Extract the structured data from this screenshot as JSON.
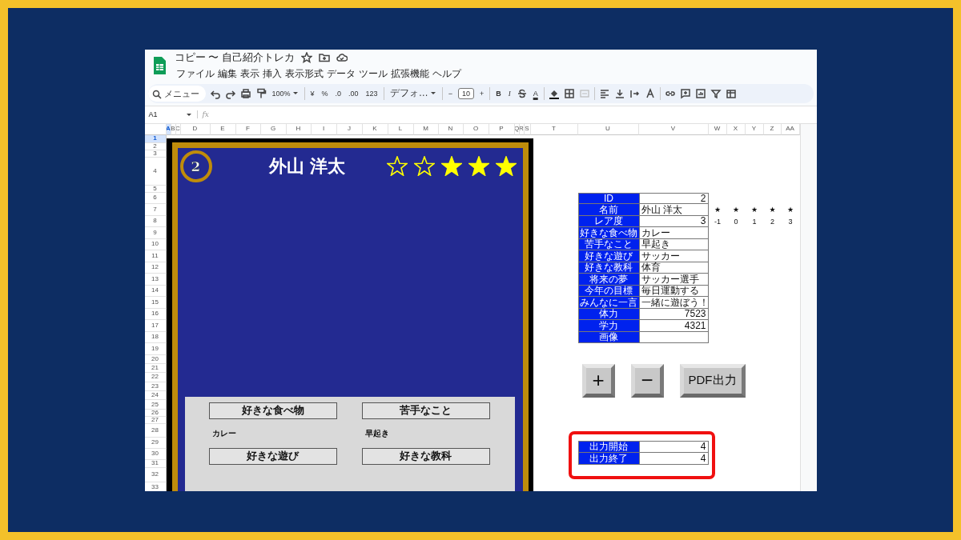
{
  "window": {
    "title": "コピー 〜 自己紹介トレカ"
  },
  "menu": [
    "ファイル",
    "編集",
    "表示",
    "挿入",
    "表示形式",
    "データ",
    "ツール",
    "拡張機能",
    "ヘルプ"
  ],
  "toolbar": {
    "search_placeholder": "メニュー",
    "zoom": "100%",
    "currency": "¥",
    "percent": "%",
    "decrease_decimal": ".0",
    "increase_decimal": ".00",
    "number_format": "123",
    "font": "デフォ…",
    "minus": "−",
    "font_size": "10",
    "plus": "+",
    "bold": "B",
    "italic": "I",
    "text_color": "A"
  },
  "formula_bar": {
    "cell_ref": "A1",
    "fx": "fx"
  },
  "columns": [
    {
      "label": "A",
      "selected": true
    },
    {
      "label": "B",
      "selected": false
    },
    {
      "label": "C",
      "selected": false
    },
    {
      "label": "D",
      "selected": false
    },
    {
      "label": "E",
      "selected": false
    },
    {
      "label": "F",
      "selected": false
    },
    {
      "label": "G",
      "selected": false
    },
    {
      "label": "H",
      "selected": false
    },
    {
      "label": "I",
      "selected": false
    },
    {
      "label": "J",
      "selected": false
    },
    {
      "label": "K",
      "selected": false
    },
    {
      "label": "L",
      "selected": false
    },
    {
      "label": "M",
      "selected": false
    },
    {
      "label": "N",
      "selected": false
    },
    {
      "label": "O",
      "selected": false
    },
    {
      "label": "P",
      "selected": false
    },
    {
      "label": "Q",
      "selected": false
    },
    {
      "label": "R",
      "selected": false
    },
    {
      "label": "S",
      "selected": false
    },
    {
      "label": "T",
      "selected": false
    },
    {
      "label": "U",
      "selected": false
    },
    {
      "label": "V",
      "selected": false
    },
    {
      "label": "W",
      "selected": false
    },
    {
      "label": "X",
      "selected": false
    },
    {
      "label": "Y",
      "selected": false
    },
    {
      "label": "Z",
      "selected": false
    },
    {
      "label": "AA",
      "selected": false
    }
  ],
  "rows": [
    {
      "label": "1",
      "selected": true
    },
    {
      "label": "2",
      "selected": false
    },
    {
      "label": "3",
      "selected": false
    },
    {
      "label": "4",
      "selected": false
    },
    {
      "label": "5",
      "selected": false
    },
    {
      "label": "6",
      "selected": false
    },
    {
      "label": "7",
      "selected": false
    },
    {
      "label": "8",
      "selected": false
    },
    {
      "label": "9",
      "selected": false
    },
    {
      "label": "10",
      "selected": false
    },
    {
      "label": "11",
      "selected": false
    },
    {
      "label": "12",
      "selected": false
    },
    {
      "label": "13",
      "selected": false
    },
    {
      "label": "14",
      "selected": false
    },
    {
      "label": "15",
      "selected": false
    },
    {
      "label": "16",
      "selected": false
    },
    {
      "label": "17",
      "selected": false
    },
    {
      "label": "18",
      "selected": false
    },
    {
      "label": "19",
      "selected": false
    },
    {
      "label": "20",
      "selected": false
    },
    {
      "label": "21",
      "selected": false
    },
    {
      "label": "22",
      "selected": false
    },
    {
      "label": "23",
      "selected": false
    },
    {
      "label": "24",
      "selected": false
    },
    {
      "label": "25",
      "selected": false
    },
    {
      "label": "26",
      "selected": false
    },
    {
      "label": "27",
      "selected": false
    },
    {
      "label": "28",
      "selected": false
    },
    {
      "label": "29",
      "selected": false
    },
    {
      "label": "30",
      "selected": false
    },
    {
      "label": "31",
      "selected": false
    },
    {
      "label": "32",
      "selected": false
    },
    {
      "label": "33",
      "selected": false
    }
  ],
  "card": {
    "number": "2",
    "name": "外山 洋太",
    "stars": 3,
    "sections": [
      {
        "heading": "好きな食べ物",
        "value": "カレー"
      },
      {
        "heading": "苦手なこと",
        "value": "早起き"
      },
      {
        "heading": "好きな遊び"
      },
      {
        "heading": "好きな教科"
      }
    ]
  },
  "profile_table": [
    {
      "label": "ID",
      "value": "2",
      "kind": "number"
    },
    {
      "label": "名前",
      "value": "外山 洋太",
      "kind": "text"
    },
    {
      "label": "レア度",
      "value": "3",
      "kind": "number"
    },
    {
      "label": "好きな食べ物",
      "value": "カレー",
      "kind": "text"
    },
    {
      "label": "苦手なこと",
      "value": "早起き",
      "kind": "text"
    },
    {
      "label": "好きな遊び",
      "value": "サッカー",
      "kind": "text"
    },
    {
      "label": "好きな教科",
      "value": "体育",
      "kind": "text"
    },
    {
      "label": "将来の夢",
      "value": "サッカー選手",
      "kind": "text"
    },
    {
      "label": "今年の目標",
      "value": "毎日運動する",
      "kind": "text"
    },
    {
      "label": "みんなに一言",
      "value": "一緒に遊ぼう！",
      "kind": "text"
    },
    {
      "label": "体力",
      "value": "7523",
      "kind": "number"
    },
    {
      "label": "学力",
      "value": "4321",
      "kind": "number"
    },
    {
      "label": "画像",
      "kind": "text"
    }
  ],
  "rarity_legend": [
    {
      "star": "★",
      "label": "-1"
    },
    {
      "star": "★",
      "label": "0"
    },
    {
      "star": "★",
      "label": "1"
    },
    {
      "star": "★",
      "label": "2"
    },
    {
      "star": "★",
      "label": "3"
    }
  ],
  "buttons": [
    "+",
    "−",
    "PDF出力"
  ],
  "output_range": {
    "highlighted": true,
    "rows": [
      {
        "label": "出力開始",
        "value": "4"
      },
      {
        "label": "出力終了",
        "value": "4"
      }
    ]
  }
}
